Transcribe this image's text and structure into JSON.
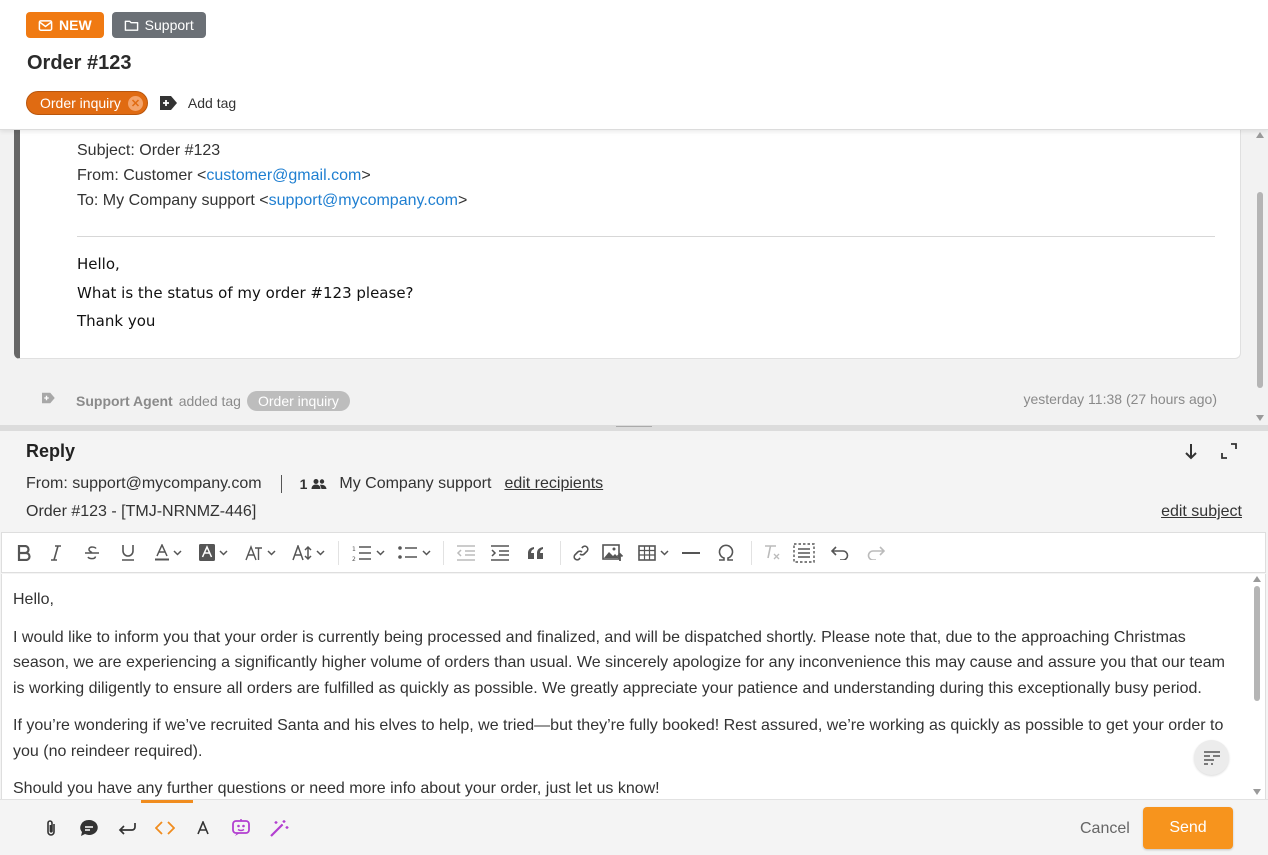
{
  "ticket": {
    "status_badge": "NEW",
    "folder_badge": "Support",
    "title": "Order #123",
    "tags": [
      "Order inquiry"
    ],
    "add_tag_label": "Add tag"
  },
  "message": {
    "subject_line": "Subject: Order #123",
    "from_prefix": "From: Customer <",
    "from_email": "customer@gmail.com",
    "from_suffix": ">",
    "to_prefix": "To: My Company support <",
    "to_email": "support@mycompany.com",
    "to_suffix": ">",
    "body": [
      "Hello,",
      "What is the status of my order #123 please?",
      "Thank you"
    ]
  },
  "event": {
    "agent": "Support Agent",
    "action": "added tag",
    "tag": "Order inquiry",
    "time": "yesterday 11:38 (27 hours ago)"
  },
  "reply": {
    "title": "Reply",
    "from_label": "From:",
    "from_email": "support@mycompany.com",
    "recipient_count": "1",
    "recipient_name": "My Company support",
    "edit_recipients": "edit recipients",
    "subject": "Order #123 - [TMJ-NRNMZ-446]",
    "edit_subject": "edit subject",
    "body": [
      "Hello,",
      "I would like to inform you that your order is currently being processed and finalized, and will be dispatched shortly. Please note that, due to the approaching Christmas season, we are experiencing a significantly higher volume of orders than usual. We sincerely apologize for any inconvenience this may cause and assure you that our team is working diligently to ensure all orders are fulfilled as quickly as possible. We greatly appreciate your patience and understanding during this exceptionally busy period.",
      "If you’re wondering if we’ve recruited Santa and his elves to help, we tried—but they’re fully booked! Rest assured, we’re working as quickly as possible to get your order to you (no reindeer required).",
      "Should you have any further questions or need more info about your order, just let us know!"
    ],
    "cancel_label": "Cancel",
    "send_label": "Send"
  },
  "toolbar_icons": [
    "bold-icon",
    "italic-icon",
    "strikethrough-icon",
    "underline-icon",
    "font-color-icon",
    "background-color-icon",
    "font-family-icon",
    "font-size-icon",
    "numbered-list-icon",
    "bulleted-list-icon",
    "outdent-icon",
    "indent-icon",
    "blockquote-icon",
    "link-icon",
    "insert-image-icon",
    "insert-table-icon",
    "horizontal-line-icon",
    "special-characters-icon",
    "remove-format-icon",
    "select-all-icon",
    "undo-icon",
    "redo-icon"
  ],
  "bottom_icons": [
    "attachment-icon",
    "canned-response-icon",
    "reply-mode-icon",
    "source-code-icon",
    "text-format-icon",
    "ai-assistant-icon",
    "ai-magic-icon"
  ],
  "colors": {
    "accent": "#f7941d",
    "badge_new": "#f07a12",
    "badge_folder": "#6b7076",
    "tag": "#e06b12",
    "link": "#1f7fd1",
    "ai": "#b23fd0"
  }
}
